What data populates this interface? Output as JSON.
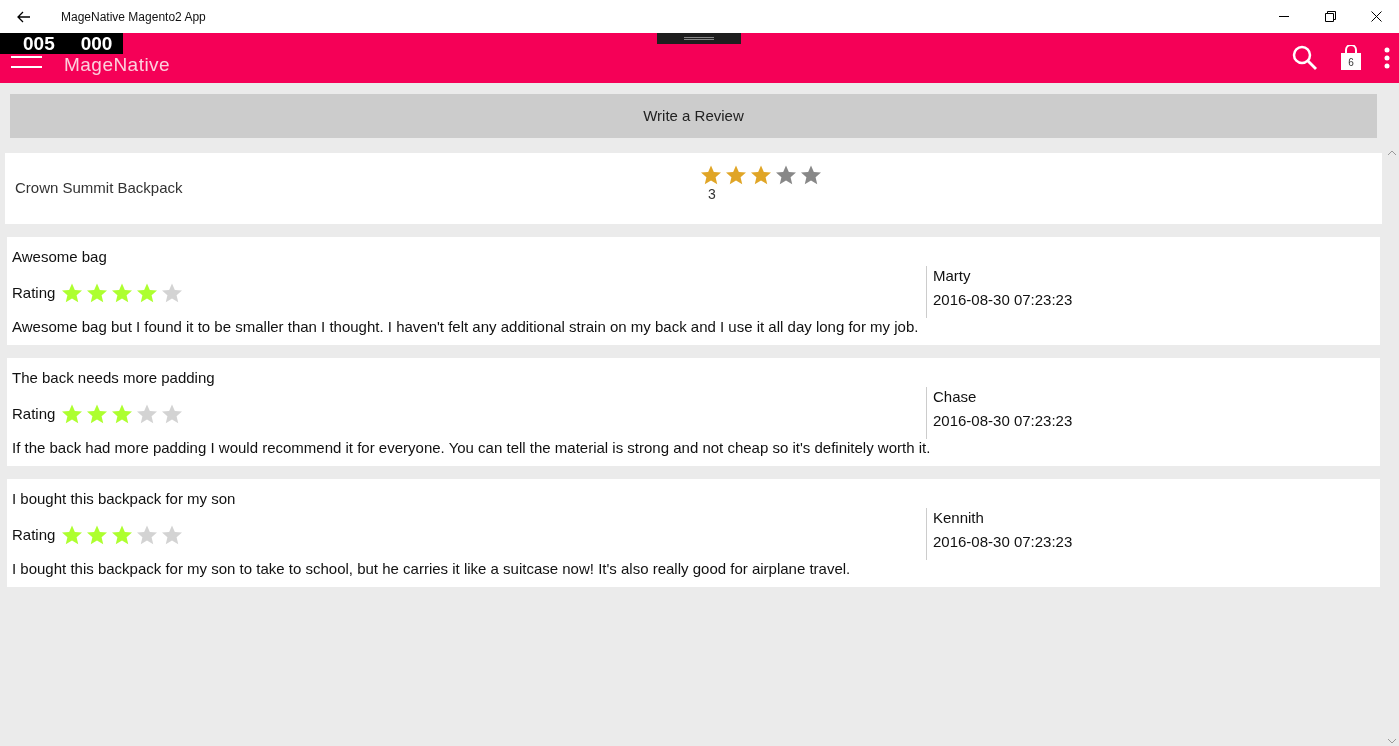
{
  "window": {
    "title": "MageNative Magento2 App"
  },
  "counter": [
    "005",
    "000"
  ],
  "app_bar": {
    "logo": "MageNative",
    "cart_count": "6"
  },
  "write_review_button": "Write a Review",
  "product": {
    "name": "Crown Summit Backpack",
    "stars": 3,
    "rating": "3"
  },
  "reviews": [
    {
      "title": "Awesome bag",
      "rating_label": "Rating",
      "stars": 4,
      "author": "Marty",
      "date": "2016-08-30 07:23:23",
      "text": "Awesome bag but I found it to be smaller than I thought. I haven't felt any additional strain on my back and I use it all day long for my job."
    },
    {
      "title": "The back needs more padding",
      "rating_label": "Rating",
      "stars": 3,
      "author": "Chase",
      "date": "2016-08-30 07:23:23",
      "text": "If the back had more padding I would recommend it for everyone. You can tell the material is strong and not cheap so it's definitely worth it."
    },
    {
      "title": "I bought this backpack for my son",
      "rating_label": "Rating",
      "stars": 3,
      "author": "Kennith",
      "date": "2016-08-30 07:23:23",
      "text": "I bought this backpack for my son to take to school, but he carries it like a suitcase now! It's also really good for airplane travel."
    }
  ]
}
